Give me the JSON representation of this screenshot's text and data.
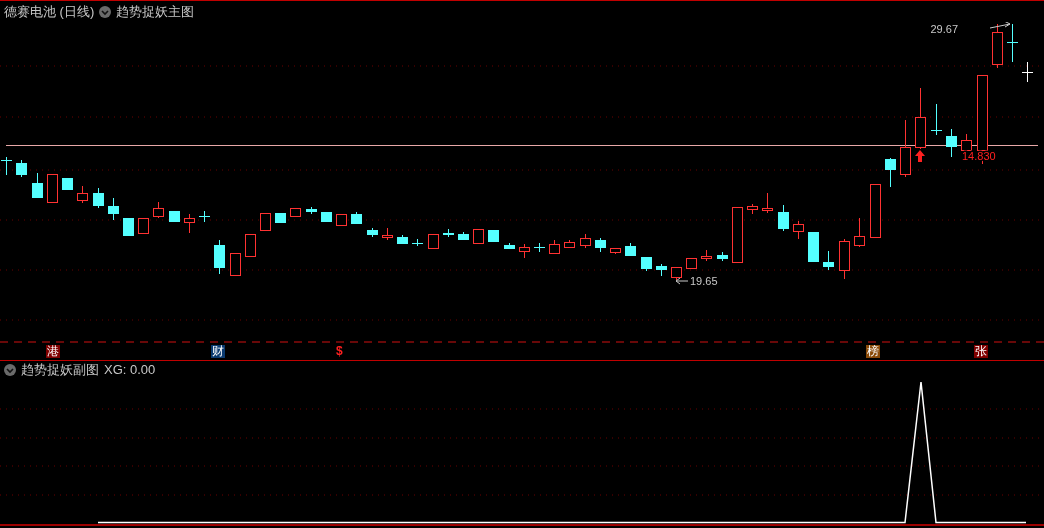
{
  "main_panel": {
    "title": "德赛电池 (日线)",
    "indicator": "趋势捉妖主图",
    "price_labels": [
      {
        "kind": "high",
        "text": "29.67"
      },
      {
        "kind": "low",
        "text": "19.65"
      },
      {
        "kind": "level",
        "text": "14.830"
      }
    ],
    "markers": [
      {
        "text": "港",
        "kind": "badge",
        "color": "#800000"
      },
      {
        "text": "财",
        "kind": "badge",
        "color": "#0a3a70"
      },
      {
        "text": "$",
        "kind": "glyph",
        "color": "#ff2020"
      },
      {
        "text": "榜",
        "kind": "badge",
        "color": "#8a4a08"
      },
      {
        "text": "张",
        "kind": "badge",
        "color": "#800000"
      }
    ]
  },
  "sub_panel": {
    "indicator": "趋势捉妖副图",
    "reading": "XG: 0.00"
  }
}
